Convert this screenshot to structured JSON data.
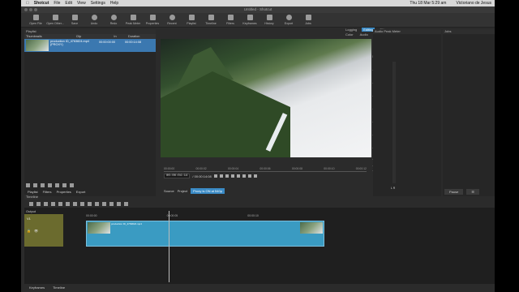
{
  "macbar": {
    "app": "Shotcut",
    "menu": [
      "File",
      "Edit",
      "View",
      "Settings",
      "Help"
    ],
    "clock": "Thu 18 Mar 5:29 am",
    "user": "Victoriano de Jesus"
  },
  "window_title": "Untitled - Shotcut",
  "toolbar": [
    "Open File",
    "Open Other...",
    "Save",
    "Undo",
    "Redo",
    "Peak Meter",
    "Properties",
    "Recent",
    "Playlist",
    "Timeline",
    "Filters",
    "Keyframes",
    "History",
    "Export",
    "Jobs"
  ],
  "layouts": {
    "items": [
      "Logging",
      "Editing",
      "FX",
      "Color",
      "Audio",
      "Player"
    ],
    "active": "Editing"
  },
  "playlist": {
    "title": "Playlist",
    "columns": [
      "Thumbnails",
      "Clip",
      "In",
      "Duration"
    ],
    "row": {
      "clip": "production ID_4763824.mp4",
      "proxy": "(PROXY)",
      "in": "00:00:00:00",
      "duration": "00:00:14:08"
    },
    "tabs": [
      "Playlist",
      "Filters",
      "Properties",
      "Export"
    ]
  },
  "player": {
    "timecode": "00:00:04:14",
    "duration": "/ 00:00:14:08",
    "ruler": [
      "00:00:00",
      "00:00:02",
      "00:00:04",
      "00:00:06",
      "00:00:08",
      "00:00:10",
      "00:00:12"
    ],
    "source_tab": "Source",
    "project_tab": "Project",
    "proxy_badge": "Proxy is ON at 540p"
  },
  "audio": {
    "title": "Audio Peak Meter",
    "scale": [
      "0",
      "-5",
      "-10",
      "-15",
      "-20",
      "-25",
      "-30",
      "-35",
      "-40",
      "-45",
      "-50"
    ],
    "lr": "L R"
  },
  "jobs": {
    "title": "Jobs",
    "pause": "Pause"
  },
  "timeline": {
    "title": "Timeline",
    "output": "Output",
    "track": "V1",
    "ruler": [
      "00:00:00",
      "00:00:05",
      "00:00:10"
    ],
    "clip_name": "production ID_4763824.mp4"
  },
  "bottom_tabs": [
    "Keyframes",
    "Timeline"
  ]
}
